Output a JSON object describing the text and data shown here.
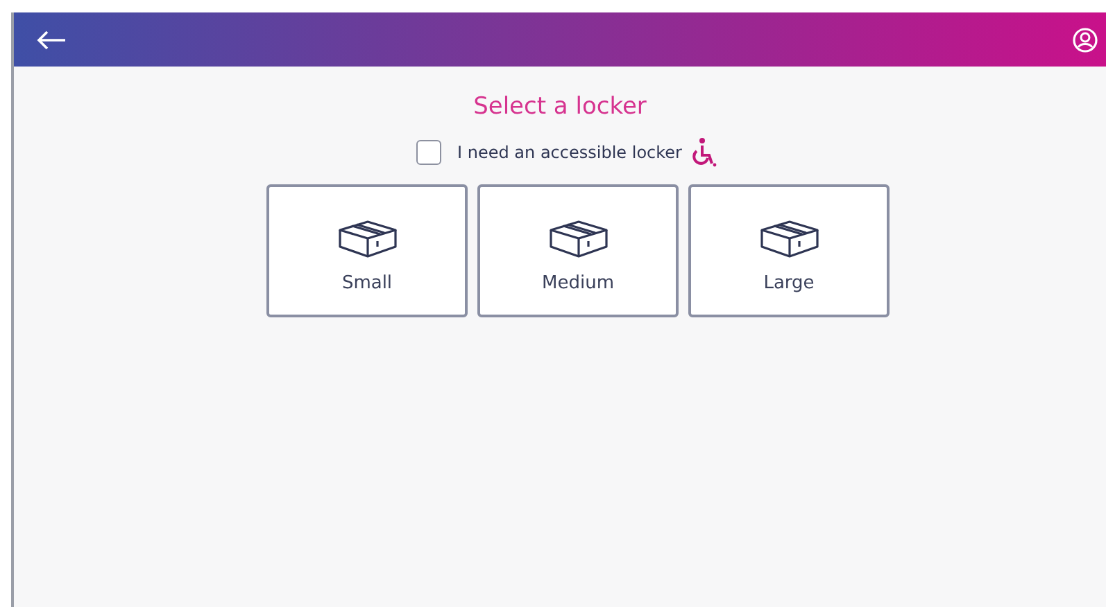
{
  "title": "Select a locker",
  "accessible": {
    "label": "I need an accessible locker",
    "checked": false
  },
  "sizes": [
    {
      "label": "Small"
    },
    {
      "label": "Medium"
    },
    {
      "label": "Large"
    }
  ]
}
